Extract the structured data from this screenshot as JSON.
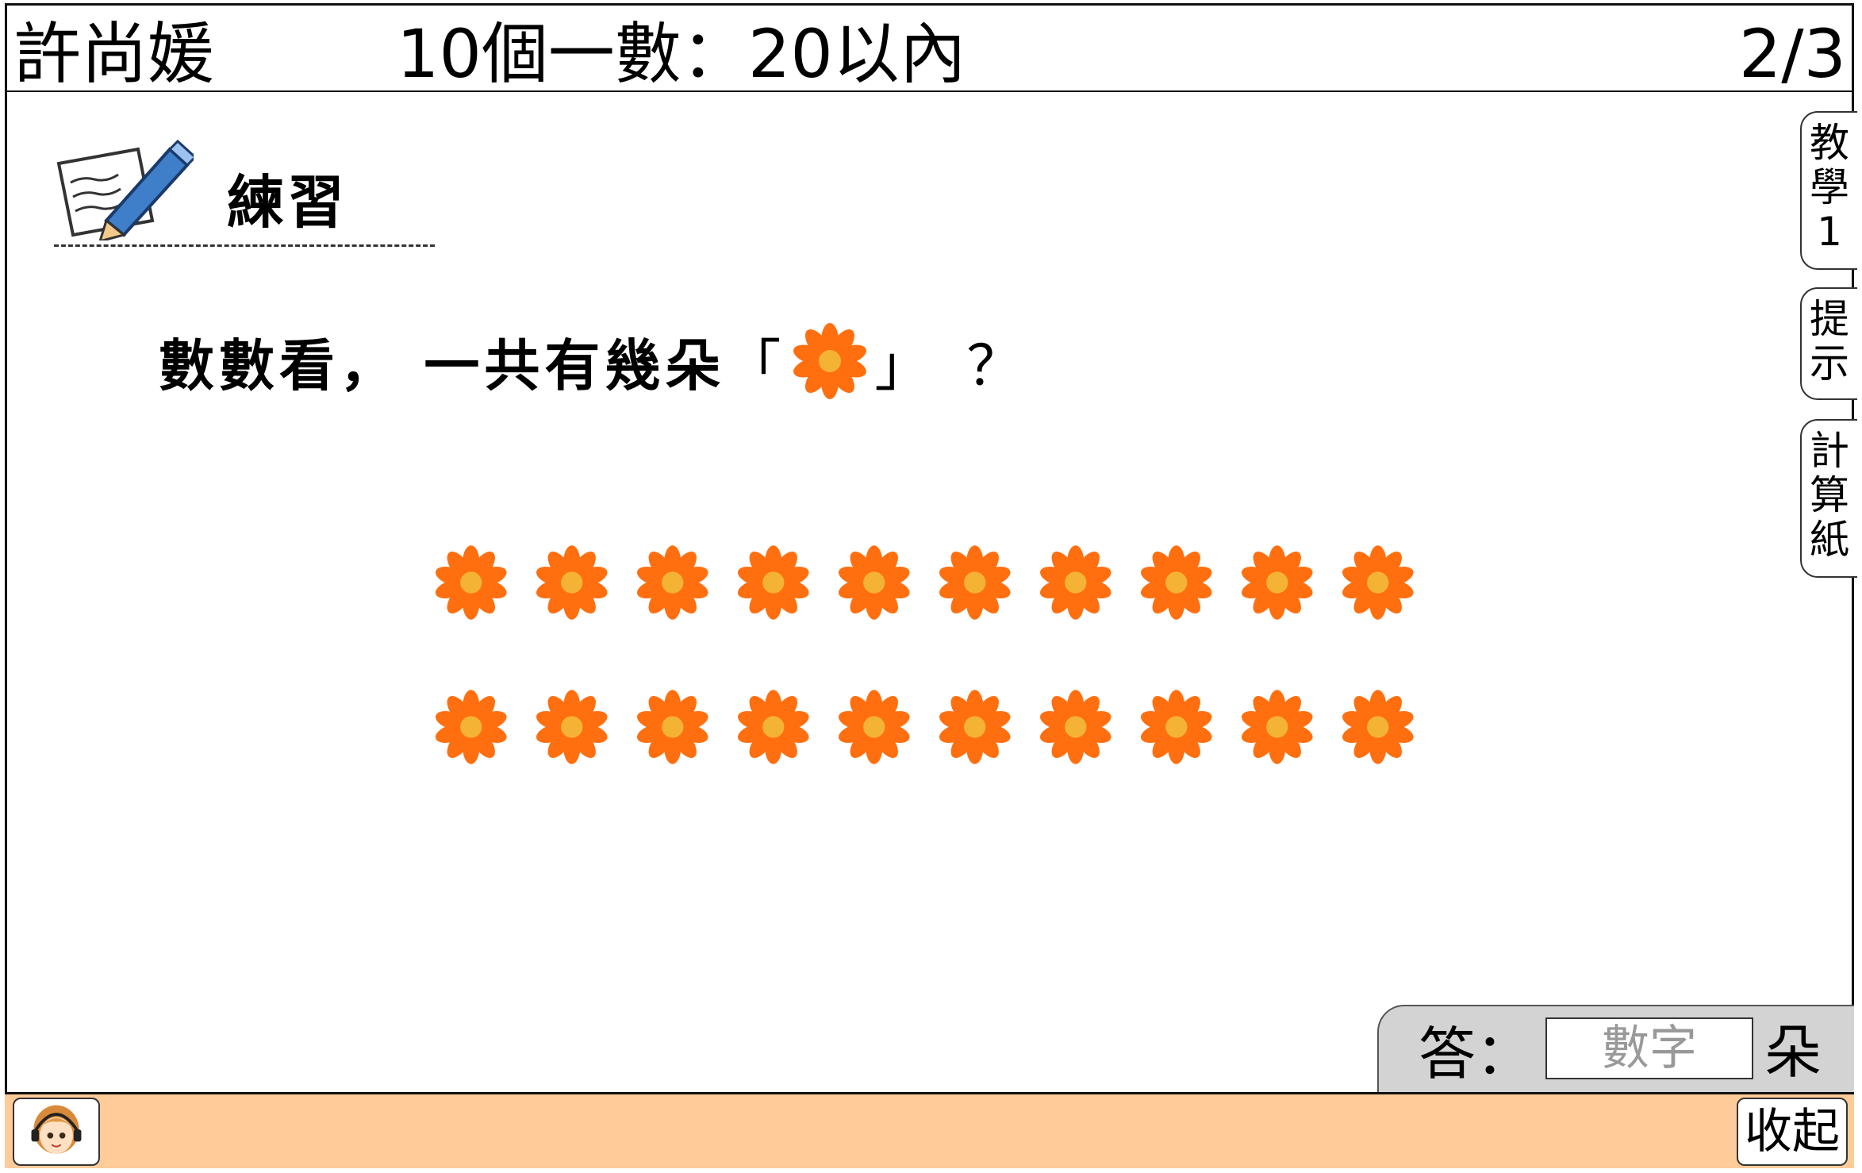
{
  "header": {
    "student_name": "許尚媛",
    "unit_title": "10個一數：20以內",
    "page_indicator": "2/3"
  },
  "practice": {
    "label": "練習"
  },
  "question": {
    "text": "數數看， 一共有幾朵",
    "open_bracket": "「",
    "close_bracket": "」",
    "question_mark": "？"
  },
  "flowers": {
    "rows": 2,
    "per_row": 10,
    "petal_color": "#ff6f10",
    "center_color": "#f5b335"
  },
  "side_tabs": {
    "teach": "教學1",
    "hint": "提示",
    "scratch_paper": "計算紙"
  },
  "answer": {
    "label": "答：",
    "placeholder": "數字",
    "value": "",
    "unit": "朵"
  },
  "footer": {
    "avatar_icon": "girl-with-headset-icon",
    "collapse_label": "收起"
  },
  "colors": {
    "footer_bg": "#ffcc99",
    "answer_panel_bg": "#d3d3d3"
  }
}
